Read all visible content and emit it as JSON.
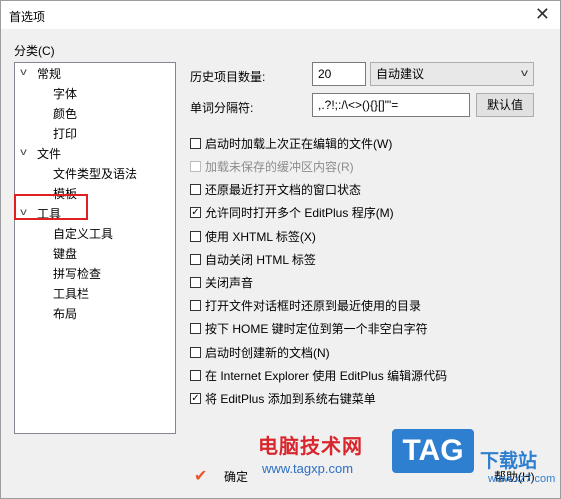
{
  "window": {
    "title": "首选项",
    "close_glyph": "✕"
  },
  "categories": {
    "label": "分类(C)",
    "tree": [
      {
        "label": "常规",
        "expanded": true
      },
      {
        "label": "字体"
      },
      {
        "label": "颜色"
      },
      {
        "label": "打印"
      },
      {
        "label": "文件",
        "expanded": true
      },
      {
        "label": "文件类型及语法"
      },
      {
        "label": "模板"
      },
      {
        "label": "工具",
        "expanded": true,
        "highlighted": true
      },
      {
        "label": "自定义工具"
      },
      {
        "label": "键盘"
      },
      {
        "label": "拼写检查"
      },
      {
        "label": "工具栏"
      },
      {
        "label": "布局"
      }
    ]
  },
  "general": {
    "history_label": "历史项目数量:",
    "history_value": "20",
    "autocomplete_value": "自动建议",
    "word_sep_label": "单词分隔符:",
    "word_sep_value": ",.?!;:/\\<>(){}[]\"'=",
    "default_button": "默认值"
  },
  "options": [
    {
      "label": "启动时加载上次正在编辑的文件(W)",
      "checked": false,
      "disabled": false
    },
    {
      "label": "加载未保存的缓冲区内容(R)",
      "checked": false,
      "disabled": true
    },
    {
      "label": "还原最近打开文档的窗口状态",
      "checked": false,
      "disabled": false
    },
    {
      "label": "允许同时打开多个 EditPlus 程序(M)",
      "checked": true,
      "disabled": false
    },
    {
      "label": "使用 XHTML 标签(X)",
      "checked": false,
      "disabled": false
    },
    {
      "label": "自动关闭 HTML 标签",
      "checked": false,
      "disabled": false
    },
    {
      "label": "关闭声音",
      "checked": false,
      "disabled": false
    },
    {
      "label": "打开文件对话框时还原到最近使用的目录",
      "checked": false,
      "disabled": false
    },
    {
      "label": "按下 HOME 键时定位到第一个非空白字符",
      "checked": false,
      "disabled": false
    },
    {
      "label": "启动时创建新的文档(N)",
      "checked": false,
      "disabled": false
    },
    {
      "label": "在 Internet Explorer 使用 EditPlus 编辑源代码",
      "checked": false,
      "disabled": false
    },
    {
      "label": "将 EditPlus 添加到系统右键菜单",
      "checked": true,
      "disabled": false
    }
  ],
  "footer": {
    "ok_label": "确定",
    "help_label": "帮助(H)"
  },
  "watermark": {
    "site_name": "电脑技术网",
    "site_url": "www.tagxp.com",
    "tag": "TAG",
    "download": "下载站",
    "url2": "www.xz7.com"
  },
  "colors": {
    "highlight_box": "#e02020",
    "checkmark": "#000000"
  }
}
